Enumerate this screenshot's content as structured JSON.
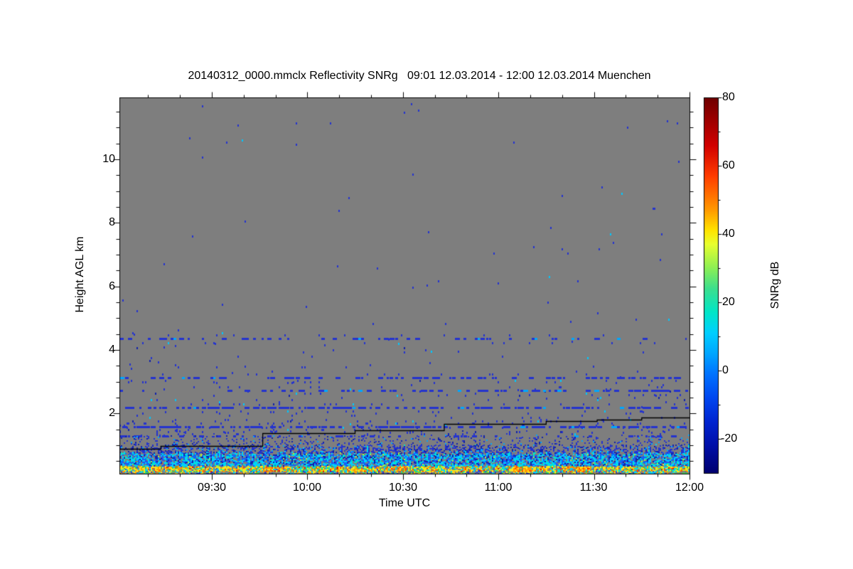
{
  "description": "Cloud radar reflectivity SNRg time-height quicklook plot, Muenchen",
  "chart_data": {
    "type": "heatmap",
    "title": "20140312_0000.mmclx Reflectivity SNRg   09:01 12.03.2014 - 12:00 12.03.2014 Muenchen",
    "xlabel": "Time UTC",
    "ylabel": "Height AGL km",
    "x_start": "09:01",
    "x_end": "12:00",
    "x_tick_labels": [
      "09:30",
      "10:00",
      "10:30",
      "11:00",
      "11:30",
      "12:00"
    ],
    "x_minor_tick_minutes": 10,
    "y_range_km": [
      0.1,
      11.95
    ],
    "y_tick_labels": [
      "10",
      "8",
      "6",
      "4",
      "2"
    ],
    "y_tick_values": [
      10,
      8,
      6,
      4,
      2
    ],
    "y_minor_tick_km": 0.5,
    "grid": false,
    "no_signal_color": "#7e7e7e",
    "colorbar": {
      "label": "SNRg dB",
      "range_db": [
        -30,
        80
      ],
      "tick_labels": [
        "80",
        "60",
        "40",
        "20",
        "0",
        "-20"
      ],
      "tick_values": [
        80,
        60,
        40,
        20,
        0,
        -20
      ],
      "minor_tick_values": [
        70,
        50,
        30,
        10,
        -10
      ],
      "stops": [
        [
          "#6e0000",
          80
        ],
        [
          "#d10000",
          66
        ],
        [
          "#ff3c00",
          57
        ],
        [
          "#ff9a00",
          47
        ],
        [
          "#ffe400",
          41
        ],
        [
          "#e8ff2e",
          37
        ],
        [
          "#8cef55",
          30
        ],
        [
          "#3cdf8e",
          24
        ],
        [
          "#00e6c8",
          17
        ],
        [
          "#00cfff",
          11
        ],
        [
          "#00a6ff",
          5
        ],
        [
          "#0073ff",
          -1
        ],
        [
          "#0047f0",
          -8
        ],
        [
          "#0024d0",
          -15
        ],
        [
          "#000fa8",
          -22
        ],
        [
          "#000070",
          -30
        ]
      ]
    },
    "cloud_base_line": {
      "color": "#000000",
      "points_time_height_km": [
        [
          "09:01",
          0.88
        ],
        [
          "09:14",
          0.97
        ],
        [
          "09:46",
          1.37
        ],
        [
          "10:15",
          1.46
        ],
        [
          "10:43",
          1.66
        ],
        [
          "11:15",
          1.75
        ],
        [
          "11:31",
          1.81
        ],
        [
          "11:45",
          1.86
        ],
        [
          "12:00",
          1.86
        ]
      ]
    },
    "plankton_layers": [
      {
        "h_km": 4.35,
        "density_left": 0.3,
        "density_right": 0.33
      },
      {
        "h_km": 3.12,
        "density_left": 0.28,
        "density_right": 0.55
      },
      {
        "h_km": 2.72,
        "density_left": 0.1,
        "density_right": 0.5
      },
      {
        "h_km": 2.18,
        "density_left": 0.58,
        "density_right": 0.48
      },
      {
        "h_km": 1.58,
        "density_left": 0.55,
        "density_right": 0.45
      },
      {
        "h_km": 1.28,
        "density_left": 0.3,
        "density_right": 0.12
      }
    ],
    "layer_dash_colors": {
      "main": "#2433cf",
      "alt": "#00a6ff",
      "alt_frac": 0.08
    },
    "boundary_layer_bands": [
      {
        "h0": 0.1,
        "h1": 0.17,
        "palette": "surface",
        "density": 0.95,
        "jitter_km": 0.02
      },
      {
        "h0": 0.17,
        "h1": 0.34,
        "palette": "warm",
        "density": 0.92,
        "jitter_km": 0.05
      },
      {
        "h0": 0.34,
        "h1": 0.74,
        "palette": "cool",
        "density": 0.88,
        "jitter_km": 0.14
      },
      {
        "h0": 0.74,
        "h1": 0.97,
        "palette": "blue",
        "density": 0.42,
        "jitter_km": 0.1
      },
      {
        "h0": 0.97,
        "h1": 1.3,
        "palette": "blue",
        "density": 0.14,
        "jitter_km": 0.08
      }
    ],
    "extra_speck_bands": [
      {
        "h0": 1.3,
        "h1": 1.78,
        "density": 0.05
      },
      {
        "h0": 1.78,
        "h1": 2.1,
        "density": 0.02
      },
      {
        "h0": 2.3,
        "h1": 3.05,
        "density": 0.015
      },
      {
        "h0": 3.25,
        "h1": 4.55,
        "density": 0.005
      }
    ],
    "ambient_speck_density": 0.0016,
    "speck_colors": {
      "blue": "#2433cf",
      "dark": "#1222aa",
      "cyan": "#00c8ff"
    },
    "palettes": {
      "surface": [
        [
          "#7e7e7e",
          0.42
        ],
        [
          "#3ed34a",
          0.12
        ],
        [
          "#00cfff",
          0.12
        ],
        [
          "#ffe41a",
          0.13
        ],
        [
          "#ff9c00",
          0.09
        ],
        [
          "#2433cf",
          0.12
        ]
      ],
      "warm": [
        [
          "#ffe41a",
          0.25
        ],
        [
          "#ff9c00",
          0.17
        ],
        [
          "#ff4d00",
          0.06
        ],
        [
          "#e81500",
          0.02
        ],
        [
          "#aef03c",
          0.1
        ],
        [
          "#3ed34a",
          0.08
        ],
        [
          "#00e6c8",
          0.1
        ],
        [
          "#00cfff",
          0.12
        ],
        [
          "#2a52e8",
          0.05
        ],
        [
          "#7e7e7e",
          0.05
        ]
      ],
      "cool": [
        [
          "#00cfff",
          0.3
        ],
        [
          "#00e6c8",
          0.12
        ],
        [
          "#2a52e8",
          0.2
        ],
        [
          "#1222aa",
          0.15
        ],
        [
          "#0073ff",
          0.13
        ],
        [
          "#aef03c",
          0.02
        ],
        [
          "#7e7e7e",
          0.08
        ]
      ],
      "blue": [
        [
          "#2433cf",
          0.68
        ],
        [
          "#1222aa",
          0.2
        ],
        [
          "#00a6ff",
          0.12
        ]
      ]
    },
    "hot_patches": [
      {
        "time": "09:12",
        "width_min": 3
      },
      {
        "time": "09:47",
        "width_min": 5
      },
      {
        "time": "10:29",
        "width_min": 4
      },
      {
        "time": "11:08",
        "width_min": 7
      },
      {
        "time": "11:24",
        "width_min": 6
      }
    ]
  }
}
